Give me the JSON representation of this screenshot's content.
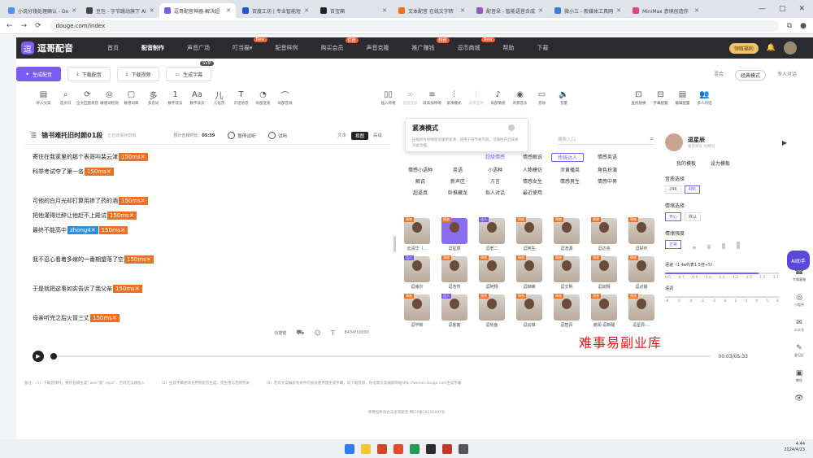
{
  "browser": {
    "tabs": [
      {
        "label": "小说分镜处理确认 - Do",
        "color": "#5b8def"
      },
      {
        "label": "豆包 - 字节跳动旗下 AI",
        "color": "#444"
      },
      {
        "label": "逗哥配音神器-解决超",
        "color": "#7a5cf0",
        "active": true
      },
      {
        "label": "百度工坊 | 专业智能短",
        "color": "#2255cc"
      },
      {
        "label": "百宝箱",
        "color": "#222"
      },
      {
        "label": "文本配音 在线文字转",
        "color": "#f07020"
      },
      {
        "label": "配音朵 - 智能语音合成",
        "color": "#9b59b6"
      },
      {
        "label": "微小三 - 新媒体工具网",
        "color": "#3b7be0"
      },
      {
        "label": "MiniMax 意境创造你",
        "color": "#d24b7a"
      }
    ],
    "url": "douge.com/index"
  },
  "header": {
    "logo_text": "逗哥配音",
    "menu": [
      {
        "label": "首页"
      },
      {
        "label": "配音制作",
        "active": true
      },
      {
        "label": "声音广场"
      },
      {
        "label": "叮当猫▾",
        "badge": "New"
      },
      {
        "label": "配音样例"
      },
      {
        "label": "购买会员",
        "badge": "优惠"
      },
      {
        "label": "声音克隆"
      },
      {
        "label": "推广赚钱",
        "badge": "特惠"
      },
      {
        "label": "逗币商城",
        "badge": "New"
      },
      {
        "label": "帮助"
      },
      {
        "label": "下载"
      }
    ],
    "vip_label": "领取福利",
    "notify_count": "10"
  },
  "actions": [
    {
      "label": "生成配音",
      "primary": true
    },
    {
      "label": "下载配音"
    },
    {
      "label": "下载视频"
    },
    {
      "label": "生成字幕",
      "tag": "SVIP"
    }
  ],
  "modes": [
    "混合",
    "经典模式",
    "多人对话"
  ],
  "tools": [
    {
      "label": "导入文案",
      "icon": "▤"
    },
    {
      "label": "选文识",
      "icon": "⌕"
    },
    {
      "label": "全文匹配发音",
      "icon": "⟳"
    },
    {
      "label": "敏感词检测",
      "icon": "◎"
    },
    {
      "label": "敏感词库",
      "icon": "▢"
    },
    {
      "label": "多音词",
      "icon": "多"
    },
    {
      "label": "数字读法",
      "icon": "1"
    },
    {
      "label": "数字读法",
      "icon": "Aa"
    },
    {
      "label": "儿化音",
      "icon": "儿"
    },
    {
      "label": "识话语音",
      "icon": "T"
    },
    {
      "label": "局部变速",
      "icon": "◔"
    },
    {
      "label": "局部音调",
      "icon": "⌒"
    }
  ],
  "tools2": [
    {
      "label": "插入停顿",
      "icon": "▯▯"
    },
    {
      "label": "语音连续",
      "icon": "∞",
      "dim": true
    },
    {
      "label": "段末加停顿",
      "icon": "≡"
    },
    {
      "label": "紧凑模式",
      "icon": "⫶"
    },
    {
      "label": "背景音效",
      "icon": "⫶",
      "dim": true
    },
    {
      "label": "局部情感",
      "icon": "♪"
    },
    {
      "label": "背景音乐",
      "icon": "◉"
    },
    {
      "label": "音效",
      "icon": "▭"
    },
    {
      "label": "音量",
      "icon": "🔈"
    }
  ],
  "tools3": [
    {
      "label": "查找替换",
      "icon": "⊡"
    },
    {
      "label": "字幕配置",
      "icon": "⊟"
    },
    {
      "label": "编辑配置",
      "icon": "▤"
    },
    {
      "label": "多人对话",
      "icon": "👥"
    }
  ],
  "editor": {
    "title": "锦书难托旧时颜01段",
    "subtitle": "已自动保存草稿",
    "duration_label": "预计音频时长：",
    "duration": "05:39",
    "controls": [
      "暂停试听",
      "试听"
    ],
    "views": [
      "文本",
      "视图",
      "高级"
    ],
    "active_view": "视图",
    "lines": [
      {
        "text": "寄住在我家里的那个表哥叫裴云津",
        "pause": "150ms✕"
      },
      {
        "text": "科举考试夺了第一名",
        "pause": "150ms✕"
      },
      {
        "text": "可他的白月光却打算用掺了药的酒",
        "pause": "150ms✕"
      },
      {
        "text": "把他灌得烂醉让他赶不上殿试",
        "pause": "150ms✕"
      },
      {
        "text": "最终不能高中",
        "pin": "zhong4✕",
        "pause": "150ms✕"
      },
      {
        "text": "我不忍心看着多嫁的一番期望落了空",
        "pause": "150ms✕"
      },
      {
        "text": "于是就把这事如实告诉了我父亲",
        "pause": "150ms✕"
      },
      {
        "text": "母亲听完之后火冒三丈",
        "pause": "150ms✕"
      }
    ],
    "footer": {
      "clear": "快捷键",
      "count": "8434/10000"
    }
  },
  "popup": {
    "title": "紧凑模式",
    "desc": "压缩所有停顿使语速更紧凑，适用于快节奏内容，可随时开启或关闭此功能。"
  },
  "voices": {
    "search_placeholder": "搜索入口",
    "categories": [
      {
        "label": "超级情感",
        "on": true
      },
      {
        "label": "情感解说"
      },
      {
        "label": "传统达人",
        "sel": true
      },
      {
        "label": "情感英语"
      },
      {
        "label": "情感小语种"
      },
      {
        "label": "英语"
      },
      {
        "label": "小语种"
      },
      {
        "label": "人物模仿"
      },
      {
        "label": "涉黄播英"
      },
      {
        "label": "角色扮演"
      },
      {
        "label": "解说"
      },
      {
        "label": "新声区"
      },
      {
        "label": "方言"
      },
      {
        "label": "情感女生"
      },
      {
        "label": "情感男生"
      },
      {
        "label": "情感中男"
      },
      {
        "label": "超逼真"
      },
      {
        "label": "卧推藏龙"
      },
      {
        "label": "拟人对话"
      },
      {
        "label": "最近使用"
      }
    ],
    "items": [
      {
        "name": "云清华（…",
        "badge": "情感"
      },
      {
        "name": "逗星辰",
        "badge": "情感",
        "active": true
      },
      {
        "name": "逗老二",
        "badge": "达人",
        "blue": true
      },
      {
        "name": "逗阿生",
        "badge": "情感"
      },
      {
        "name": "逗浩源",
        "badge": "情感"
      },
      {
        "name": "逗达兆",
        "badge": "情感"
      },
      {
        "name": "逗好环",
        "badge": "情感"
      },
      {
        "name": "逗威尔",
        "badge": "达人",
        "blue": true
      },
      {
        "name": "逗浩然",
        "badge": "情感"
      },
      {
        "name": "逗阿翔",
        "badge": "情感"
      },
      {
        "name": "逗柳峰",
        "badge": "情感"
      },
      {
        "name": "逗文熙",
        "badge": "情感"
      },
      {
        "name": "逗如翔",
        "badge": "情感"
      },
      {
        "name": "逗必娟",
        "badge": "情感"
      },
      {
        "name": "逗毕彬",
        "badge": "情感"
      },
      {
        "name": "逗客客",
        "badge": "达人",
        "blue": true
      },
      {
        "name": "逗欣鱼",
        "badge": "情感"
      },
      {
        "name": "逗云琪",
        "badge": "情感"
      },
      {
        "name": "逗智青",
        "badge": "情感"
      },
      {
        "name": "谢闻-逗新醒",
        "badge": "情感"
      },
      {
        "name": "逗星辰-…",
        "badge": "情感"
      }
    ]
  },
  "settings": {
    "speaker_name": "逗星辰",
    "speaker_sub": "播音男女 达顾问",
    "links": [
      "我的模板",
      "设为模板"
    ],
    "sample_rate_label": "音质选择",
    "sample_rates": [
      "24K",
      "48K"
    ],
    "emotion_label": "情绪选择",
    "emotions": [
      "开心",
      "默认"
    ],
    "intensity_label": "情绪强度",
    "intensity_value": "正常",
    "speed_label": "语速（1.4x代表1.5倍+5）",
    "speed_ticks": [
      "0.5",
      "0.7",
      "0.9",
      "1.0",
      "1.1",
      "1.2",
      "1.3",
      "1.5",
      "1.7"
    ],
    "speed_value": 0.82,
    "pitch_label": "语调",
    "pitch_ticks": [
      "-6",
      "-5",
      "-4",
      "-3",
      "-2",
      "0",
      "2",
      "3",
      "4",
      "5",
      "6"
    ]
  },
  "sidebar": [
    {
      "label": "专属客服",
      "icon": "☎"
    },
    {
      "label": "小程序",
      "icon": "◎"
    },
    {
      "label": "公众号",
      "icon": "✉"
    },
    {
      "label": "意见反",
      "icon": "✎"
    },
    {
      "label": "教程",
      "icon": "▣"
    },
    {
      "label": "",
      "icon": "👁"
    }
  ],
  "robot_label": "AI助手",
  "player": {
    "time": "00:03/05:33",
    "progress": 0.0
  },
  "notes": [
    "备注：（1）下载音频时，要存名填生成\".wav\"或\".mp3\"，否则无法播放入",
    "（2）生成字幕更改先用所配音生成，完生用与音频完米",
    "（3）若有文案编新有余件的会员使用量生成字幕，同下载音频，你也需文案编新网站http://wenan.douge.com生成字幕"
  ],
  "icp": "粤粤投所有合法逗哥配音  粤ICP备19136497号",
  "watermark": "难事易副业库",
  "clock": {
    "time": "4:44",
    "date": "2024/4/23"
  }
}
